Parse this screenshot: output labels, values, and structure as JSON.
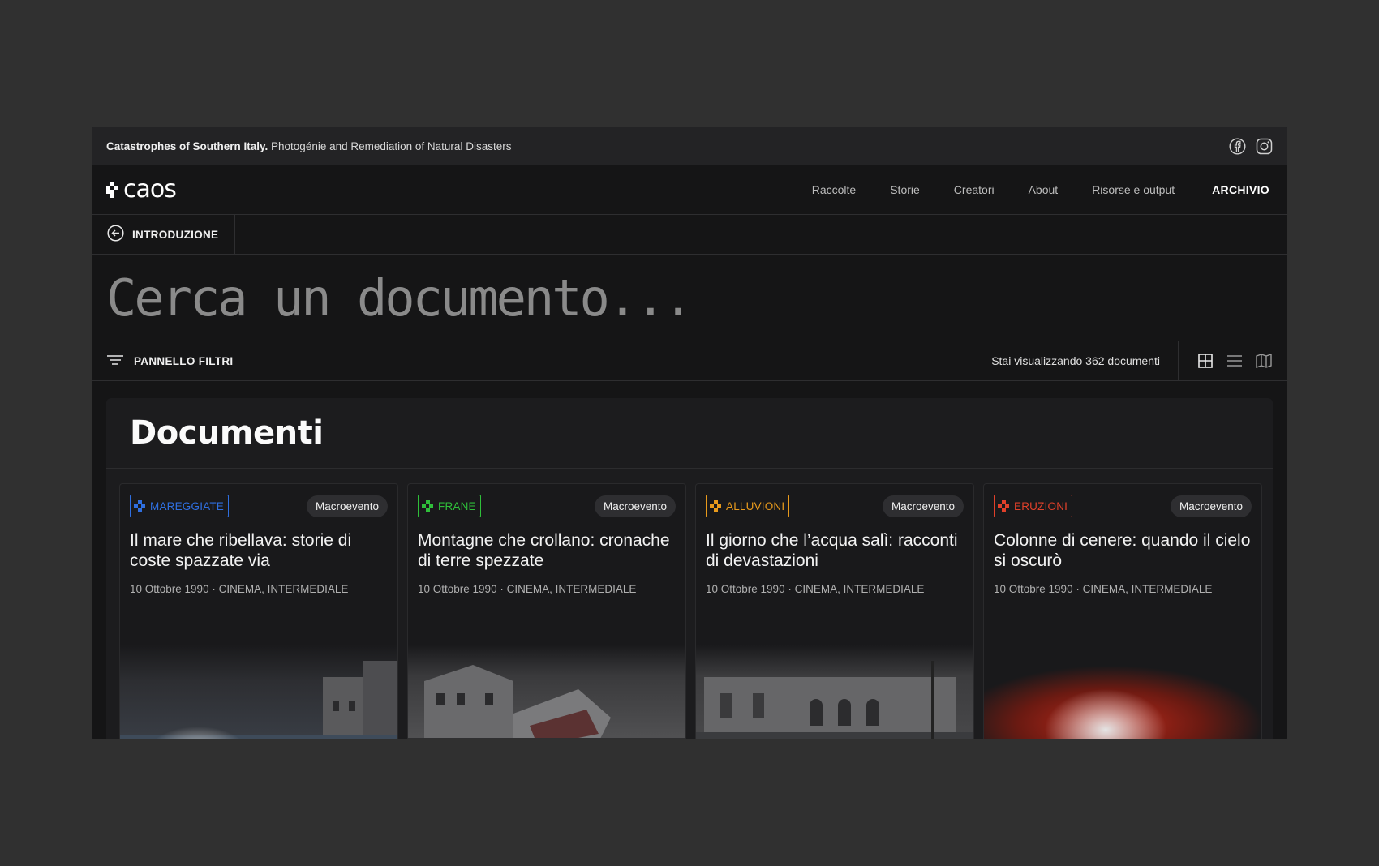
{
  "infobar": {
    "title_bold": "Catastrophes of Southern Italy.",
    "title_rest": " Photogénie and Remediation of Natural Disasters",
    "social": [
      "facebook-icon",
      "instagram-icon"
    ]
  },
  "nav": {
    "logo": "caos",
    "links": [
      "Raccolte",
      "Storie",
      "Creatori",
      "About",
      "Risorse e output"
    ],
    "archive": "ARCHIVIO"
  },
  "breadcrumb": {
    "label": "INTRODUZIONE",
    "icon": "arrow-left-circle-icon"
  },
  "search": {
    "placeholder": "Cerca un documento..."
  },
  "filters": {
    "label": "PANNELLO FILTRI",
    "count_text": "Stai visualizzando 362 documenti",
    "views": [
      "grid-view-icon",
      "list-view-icon",
      "map-view-icon"
    ]
  },
  "documents": {
    "title": "Documenti",
    "cards": [
      {
        "tag": "MAREGGIATE",
        "tag_color": "#2f6fe0",
        "badge": "Macroevento",
        "title": "Il mare che ribellava: storie di coste spazzate via",
        "meta": "10 Ottobre 1990 · CINEMA, INTERMEDIALE"
      },
      {
        "tag": "FRANE",
        "tag_color": "#2fbf3a",
        "badge": "Macroevento",
        "title": "Montagne che crollano: cronache di terre spezzate",
        "meta": "10 Ottobre 1990 · CINEMA, INTERMEDIALE"
      },
      {
        "tag": "ALLUVIONI",
        "tag_color": "#e89a1c",
        "badge": "Macroevento",
        "title": "Il giorno che l’acqua salì: racconti di devastazioni",
        "meta": "10 Ottobre 1990 · CINEMA, INTERMEDIALE"
      },
      {
        "tag": "ERUZIONI",
        "tag_color": "#e0402a",
        "badge": "Macroevento",
        "title": "Colonne di cenere: quando il cielo si oscurò",
        "meta": "10 Ottobre 1990 · CINEMA, INTERMEDIALE"
      }
    ]
  }
}
